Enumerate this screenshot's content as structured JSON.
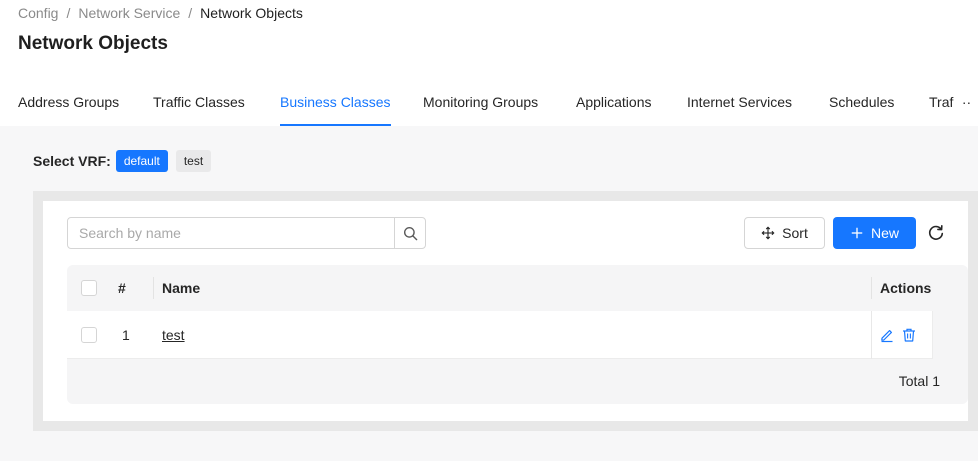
{
  "breadcrumb": [
    "Config",
    "Network Service",
    "Network Objects"
  ],
  "page_title": "Network Objects",
  "tabs": [
    {
      "label": "Address Groups"
    },
    {
      "label": "Traffic Classes"
    },
    {
      "label": "Business Classes",
      "active": true
    },
    {
      "label": "Monitoring Groups"
    },
    {
      "label": "Applications"
    },
    {
      "label": "Internet Services"
    },
    {
      "label": "Schedules"
    },
    {
      "label": "Traf"
    }
  ],
  "tabs_more": "··",
  "vrf": {
    "label": "Select VRF:",
    "options": [
      {
        "label": "default",
        "selected": true
      },
      {
        "label": "test",
        "selected": false
      }
    ]
  },
  "toolbar": {
    "search_placeholder": "Search by name",
    "search_value": "",
    "sort_label": "Sort",
    "new_label": "New"
  },
  "table": {
    "columns": {
      "index": "#",
      "name": "Name",
      "actions": "Actions"
    },
    "rows": [
      {
        "index": "1",
        "name": "test"
      }
    ],
    "total_label": "Total 1"
  },
  "colors": {
    "accent": "#1677ff",
    "text": "#262626",
    "muted": "#8a8a8a",
    "content_bg": "#f7f7f8"
  },
  "icons": {
    "search": "search-icon",
    "sort": "move-icon",
    "new": "plus-icon",
    "refresh": "refresh-icon",
    "edit": "edit-icon",
    "delete": "trash-icon"
  }
}
